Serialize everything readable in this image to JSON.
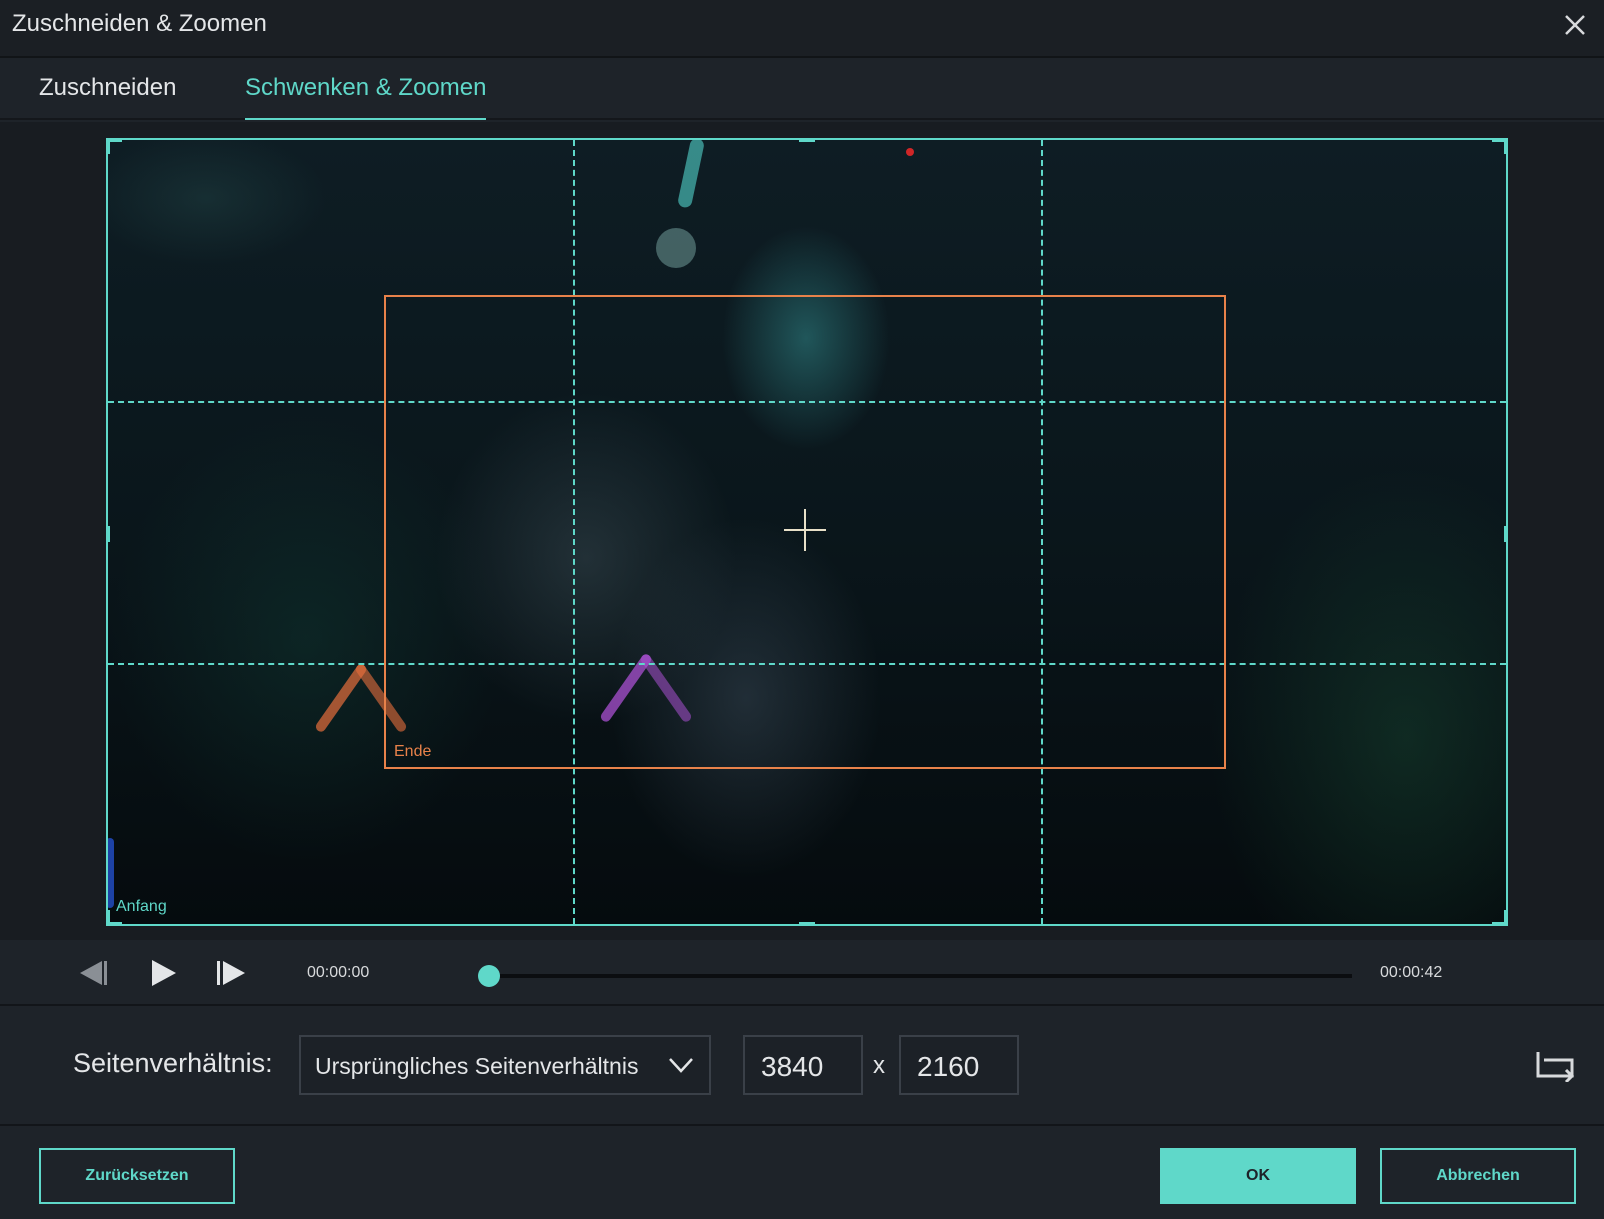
{
  "window": {
    "title": "Zuschneiden & Zoomen",
    "close_icon": "close-icon"
  },
  "tabs": [
    {
      "label": "Zuschneiden",
      "active": false
    },
    {
      "label": "Schwenken & Zoomen",
      "active": true
    }
  ],
  "preview": {
    "start_label": "Anfang",
    "end_label": "Ende",
    "colors": {
      "start_frame": "#5fd8c9",
      "end_frame": "#e8824a"
    }
  },
  "playback": {
    "current_time": "00:00:00",
    "total_time": "00:00:42",
    "progress": 0
  },
  "aspect": {
    "label": "Seitenverhältnis:",
    "selected": "Ursprüngliches Seitenverhältnis",
    "width": "3840",
    "separator": "x",
    "height": "2160"
  },
  "footer": {
    "reset_label": "Zurücksetzen",
    "ok_label": "OK",
    "cancel_label": "Abbrechen"
  },
  "colors": {
    "accent": "#5fd8c9",
    "background": "#1e2329"
  }
}
